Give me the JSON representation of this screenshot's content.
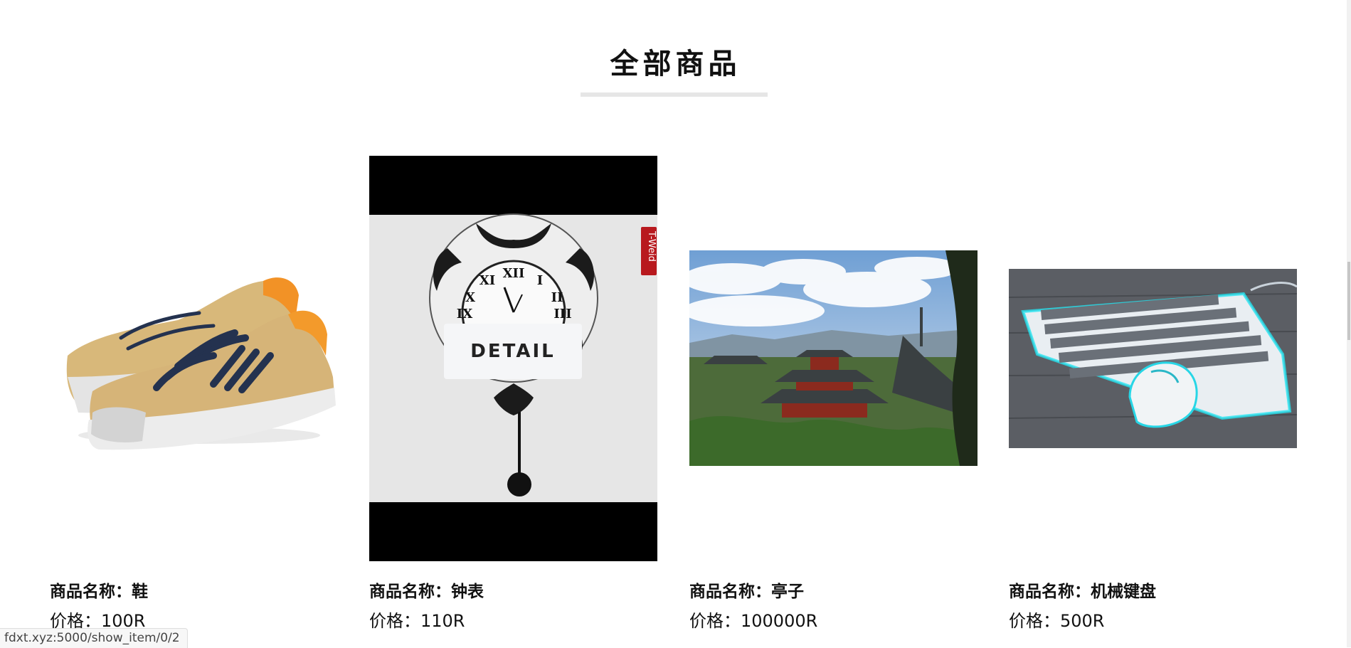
{
  "page": {
    "title": "全部商品"
  },
  "products": [
    {
      "name": "商品名称：鞋",
      "price": "价格：100R",
      "image_subject": "sneakers"
    },
    {
      "name": "商品名称：钟表",
      "price": "价格：110R",
      "image_subject": "wall-clock",
      "detail_label": "DETAIL",
      "brand_tag": "T-Weid"
    },
    {
      "name": "商品名称：亭子",
      "price": "价格：100000R",
      "image_subject": "pavilion"
    },
    {
      "name": "商品名称：机械键盘",
      "price": "价格：500R",
      "image_subject": "mechanical-keyboard"
    }
  ],
  "status_bar": {
    "url": "fdxt.xyz:5000/show_item/0/2"
  },
  "colors": {
    "background": "#ffffff",
    "divider": "#e6e6e6",
    "button_bg": "#f5f6f8",
    "tag_red": "#b8191e"
  }
}
